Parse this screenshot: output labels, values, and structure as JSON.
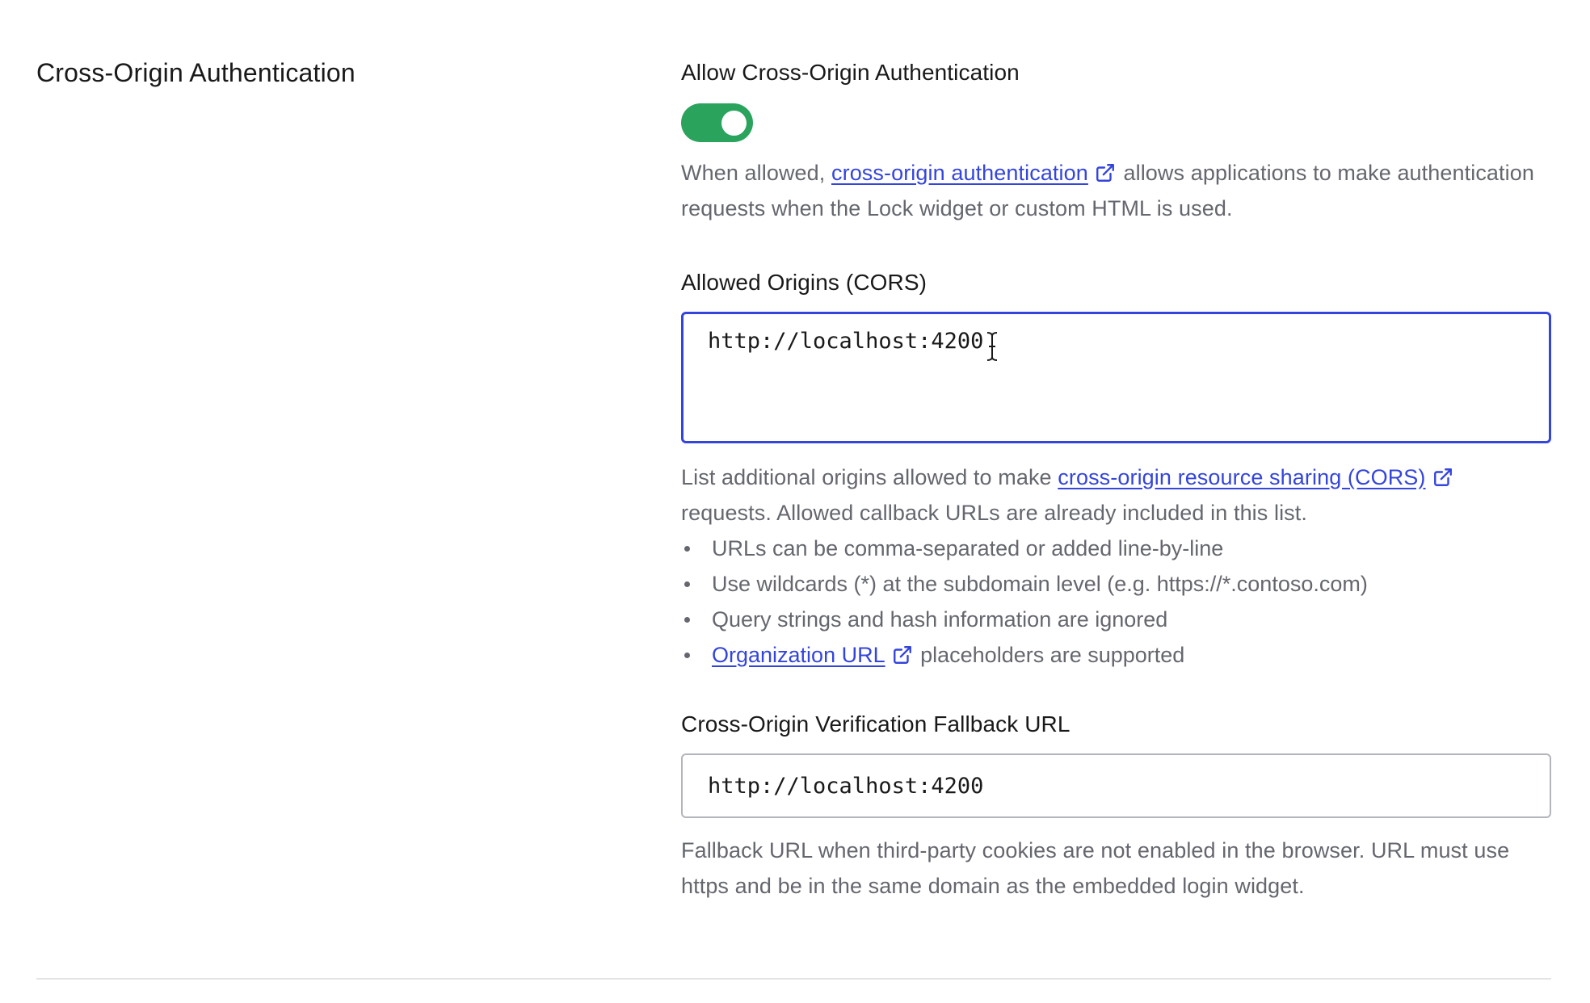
{
  "section": {
    "title": "Cross-Origin Authentication"
  },
  "allow_cross_origin": {
    "label": "Allow Cross-Origin Authentication",
    "enabled": true,
    "toggle_color": "#2aa35d",
    "help_prefix": "When allowed, ",
    "help_link": "cross-origin authentication",
    "help_suffix": " allows applications to make authentication requests when the Lock widget or custom HTML is used."
  },
  "allowed_origins": {
    "label": "Allowed Origins (CORS)",
    "value": "http://localhost:4200",
    "help_prefix": "List additional origins allowed to make ",
    "help_link": "cross-origin resource sharing (CORS)",
    "help_suffix": " requests. Allowed callback URLs are already included in this list.",
    "bullets": [
      "URLs can be comma-separated or added line-by-line",
      "Use wildcards (*) at the subdomain level (e.g. https://*.contoso.com)",
      "Query strings and hash information are ignored"
    ],
    "last_bullet_link": "Organization URL",
    "last_bullet_suffix": " placeholders are supported"
  },
  "fallback_url": {
    "label": "Cross-Origin Verification Fallback URL",
    "value": "http://localhost:4200",
    "help": "Fallback URL when third-party cookies are not enabled in the browser. URL must use https and be in the same domain as the embedded login widget."
  },
  "colors": {
    "accent": "#3445dc",
    "success": "#2aa35d",
    "muted_text": "#65676e"
  }
}
